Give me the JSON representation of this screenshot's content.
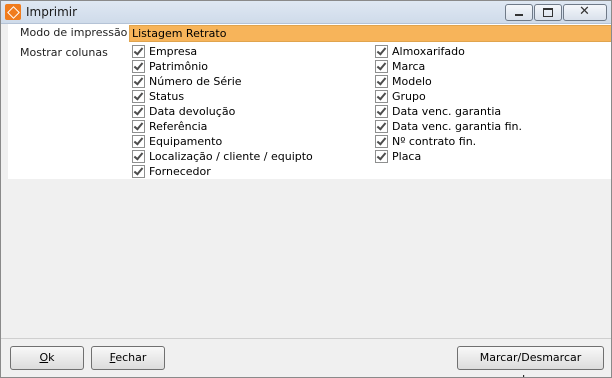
{
  "window": {
    "title": "Imprimir"
  },
  "form": {
    "print_mode_label": "Modo de impressão",
    "print_mode_value": "Listagem Retrato",
    "show_columns_label": "Mostrar colunas"
  },
  "columns_left": [
    {
      "label": "Empresa",
      "checked": true
    },
    {
      "label": "Patrimônio",
      "checked": true
    },
    {
      "label": "Número de Série",
      "checked": true
    },
    {
      "label": "Status",
      "checked": true
    },
    {
      "label": "Data devolução",
      "checked": true
    },
    {
      "label": "Referência",
      "checked": true
    },
    {
      "label": "Equipamento",
      "checked": true
    },
    {
      "label": "Localização / cliente / equipto",
      "checked": true
    },
    {
      "label": "Fornecedor",
      "checked": true
    }
  ],
  "columns_right": [
    {
      "label": "Almoxarifado",
      "checked": true
    },
    {
      "label": "Marca",
      "checked": true
    },
    {
      "label": "Modelo",
      "checked": true
    },
    {
      "label": "Grupo",
      "checked": true
    },
    {
      "label": "Data venc. garantia",
      "checked": true
    },
    {
      "label": "Data venc. garantia fin.",
      "checked": true
    },
    {
      "label": "Nº contrato fin.",
      "checked": true
    },
    {
      "label": "Placa",
      "checked": true
    }
  ],
  "buttons": {
    "ok_first": "O",
    "ok_rest": "k",
    "close_first": "F",
    "close_rest": "echar",
    "toggle_columns": "Marcar/Desmarcar colunas"
  },
  "colors": {
    "highlight": "#f7b45a",
    "app_icon": "#f07c1e"
  },
  "icons": [
    "app-icon",
    "minimize-icon",
    "maximize-icon",
    "close-icon",
    "checkmark-icon"
  ]
}
